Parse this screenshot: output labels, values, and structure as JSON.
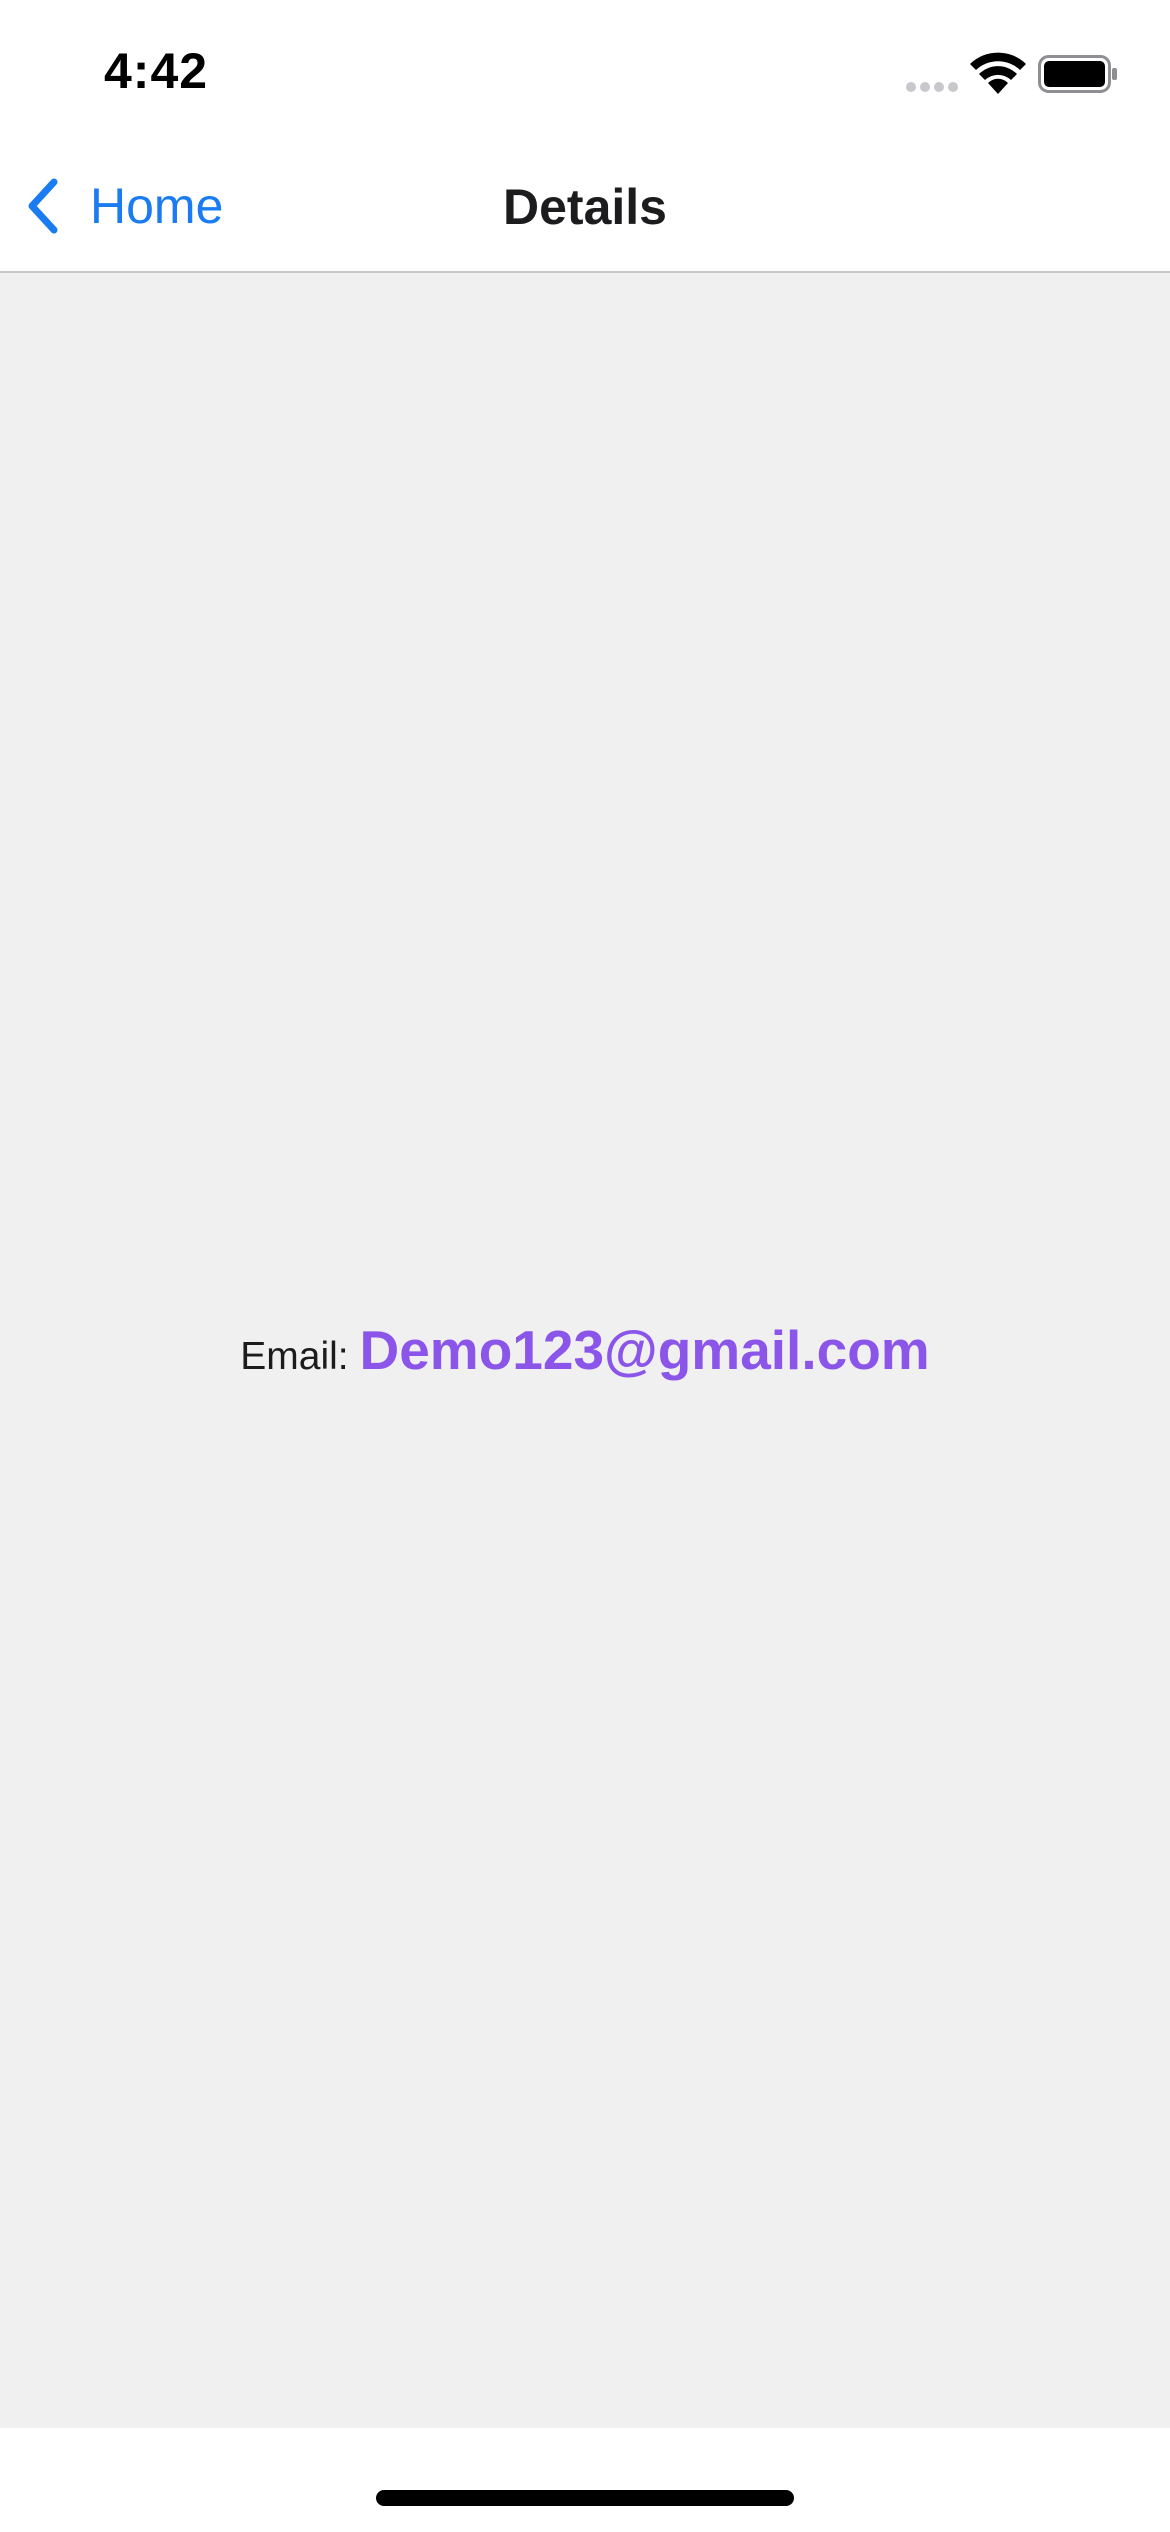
{
  "status_bar": {
    "time": "4:42",
    "icons": [
      "cellular-signal-icon",
      "wifi-icon",
      "battery-icon"
    ]
  },
  "nav": {
    "back_label": "Home",
    "title": "Details"
  },
  "content": {
    "email_label": "Email:",
    "email_value": "Demo123@gmail.com"
  },
  "colors": {
    "accent_blue": "#1a7cf0",
    "email_purple": "#8a55e8",
    "content_background": "#f0f0f0"
  }
}
